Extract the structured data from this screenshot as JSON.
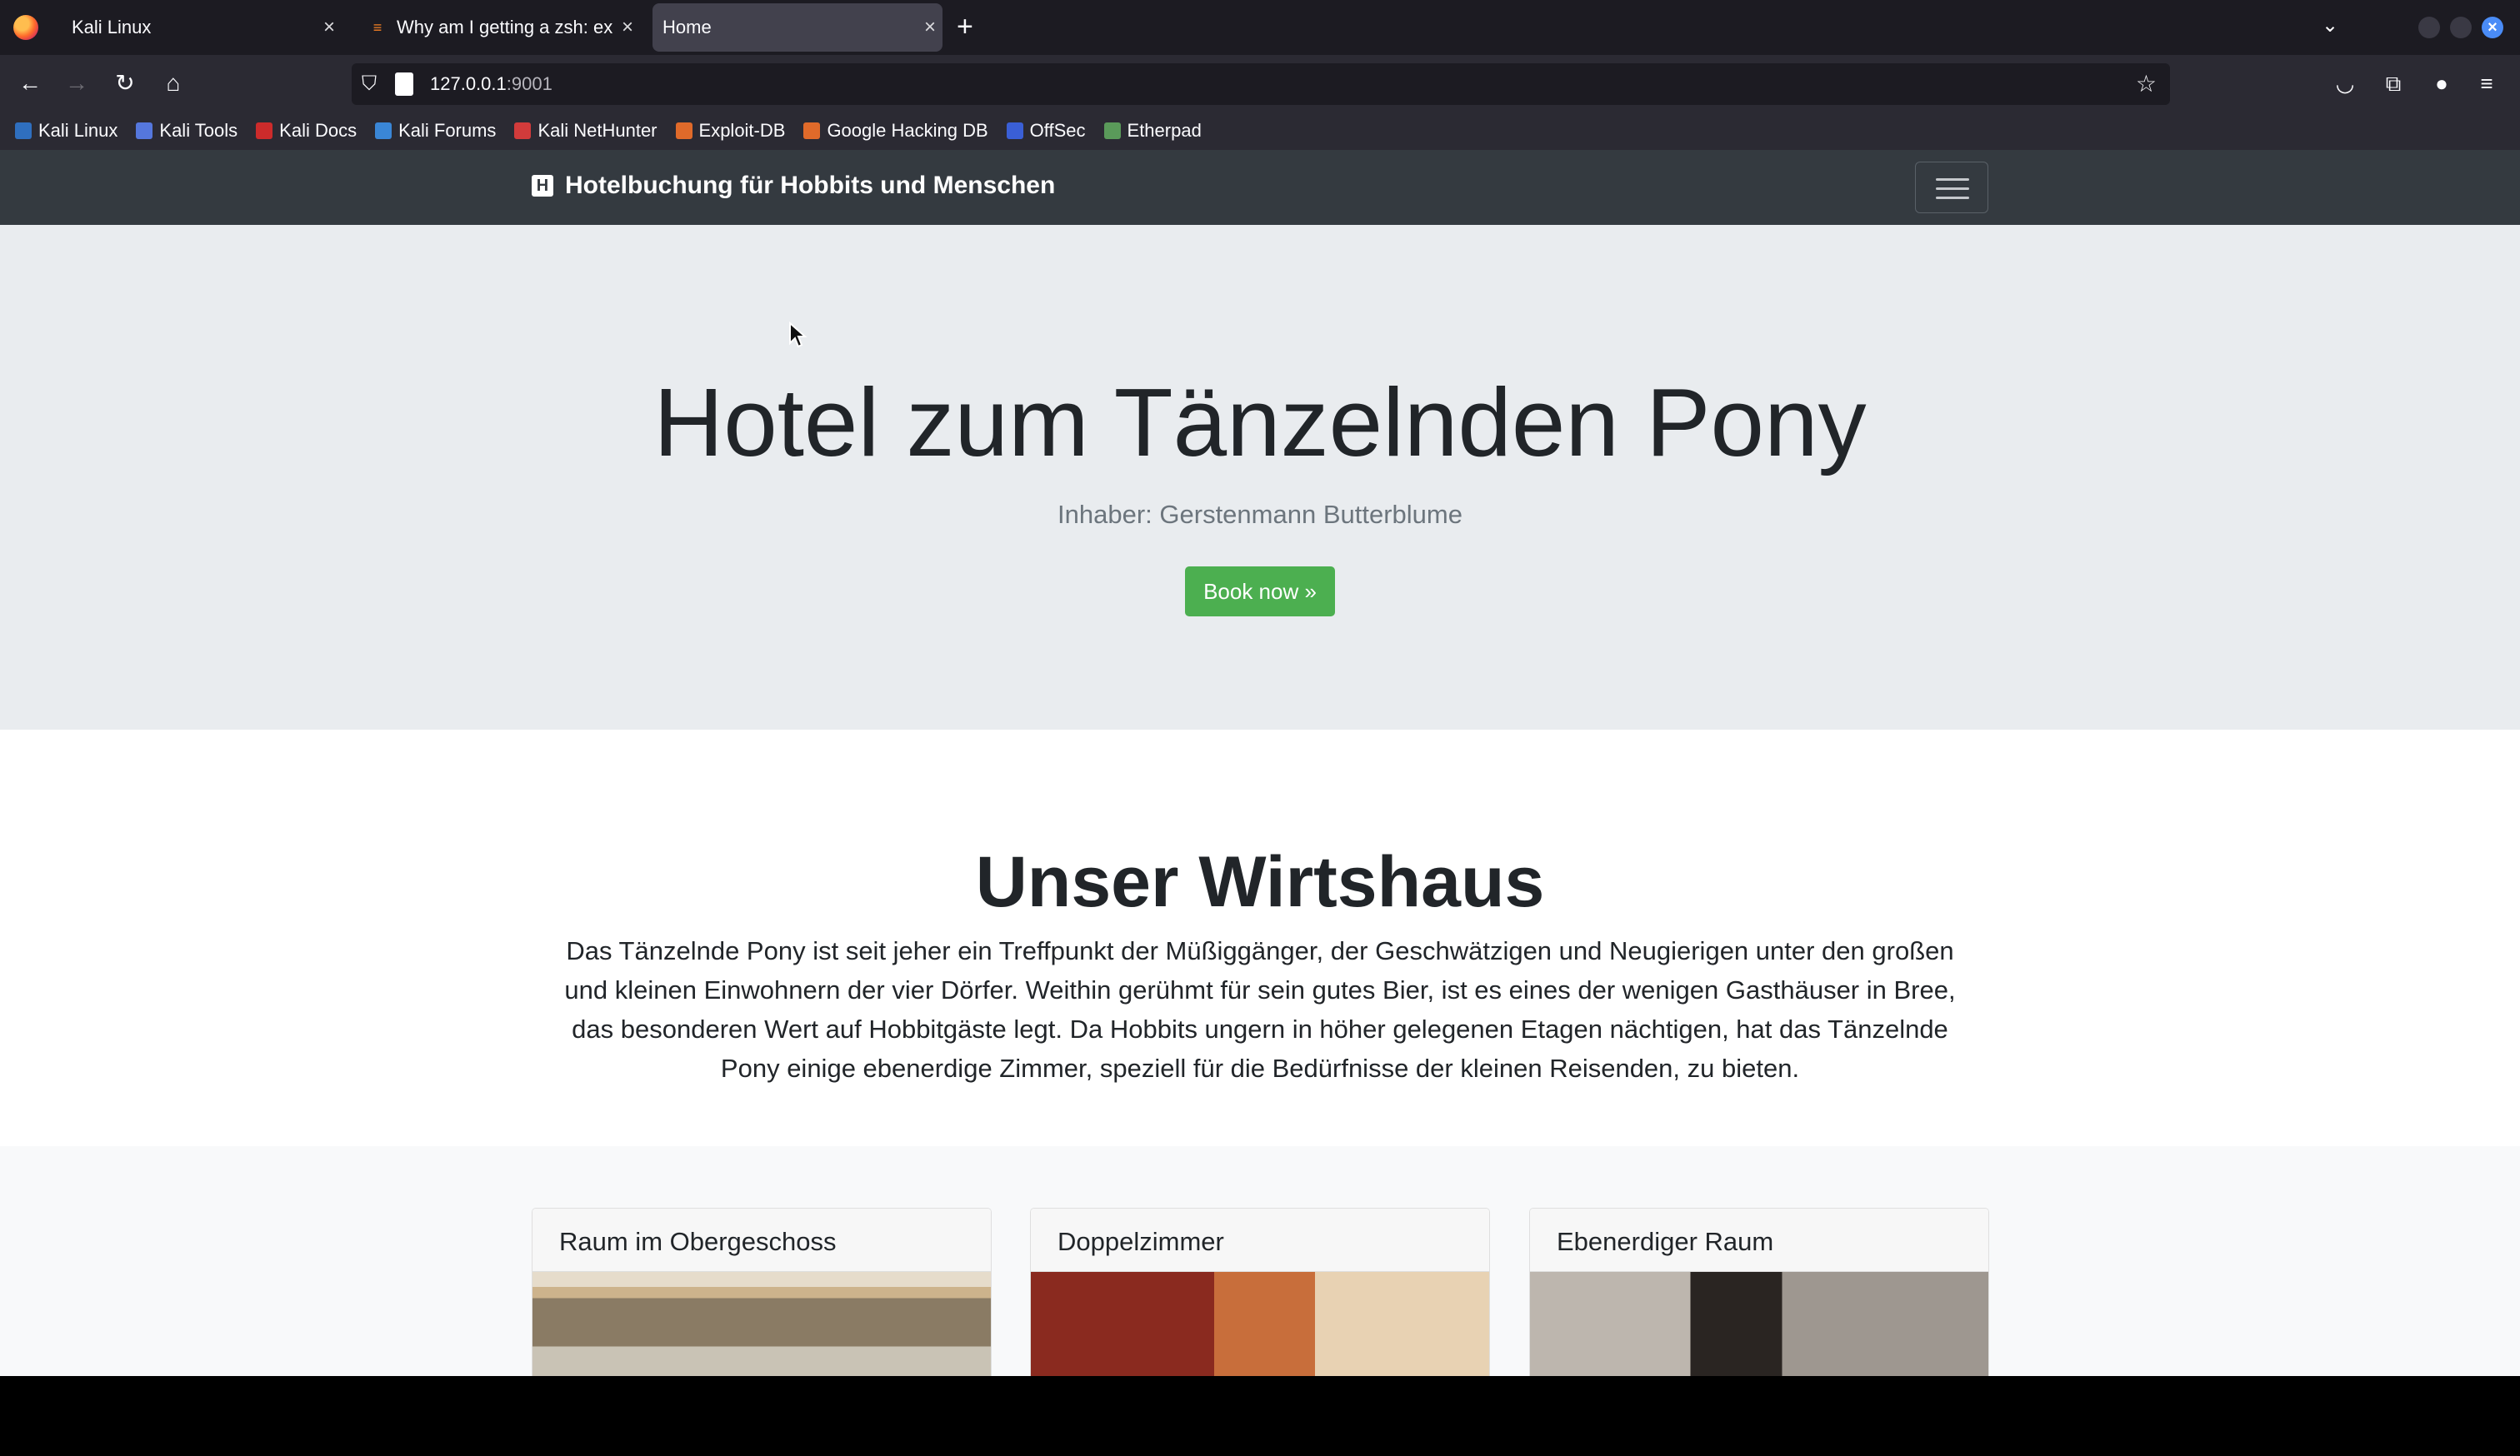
{
  "browser": {
    "tabs": [
      {
        "title": "Kali Linux",
        "active": false
      },
      {
        "title": "Why am I getting a zsh: ex",
        "active": false
      },
      {
        "title": "Home",
        "active": true
      }
    ],
    "url_host": "127.0.0.1",
    "url_port": ":9001",
    "bookmarks": [
      {
        "label": "Kali Linux",
        "color": "#2f6fbf"
      },
      {
        "label": "Kali Tools",
        "color": "#5577dd"
      },
      {
        "label": "Kali Docs",
        "color": "#cc2b2b"
      },
      {
        "label": "Kali Forums",
        "color": "#3a86d6"
      },
      {
        "label": "Kali NetHunter",
        "color": "#d23b3b"
      },
      {
        "label": "Exploit-DB",
        "color": "#e06a2a"
      },
      {
        "label": "Google Hacking DB",
        "color": "#e06a2a"
      },
      {
        "label": "OffSec",
        "color": "#3a5fd6"
      },
      {
        "label": "Etherpad",
        "color": "#5a9a5a"
      }
    ]
  },
  "site": {
    "brand_icon": "H",
    "brand": "Hotelbuchung für Hobbits und Menschen",
    "hero_title": "Hotel zum Tänzelnden Pony",
    "hero_subtitle": "Inhaber: Gerstenmann Butterblume",
    "book_button": "Book now »",
    "about_title": "Unser Wirtshaus",
    "about_text": "Das Tänzelnde Pony ist seit jeher ein Treffpunkt der Müßiggänger, der Geschwätzigen und Neugierigen unter den großen und kleinen Einwohnern der vier Dörfer. Weithin gerühmt für sein gutes Bier, ist es eines der wenigen Gasthäuser in Bree, das besonderen Wert auf Hobbitgäste legt. Da Hobbits ungern in höher gelegenen Etagen nächtigen, hat das Tänzelnde Pony einige ebenerdige Zimmer, speziell für die Bedürfnisse der kleinen Reisenden, zu bieten.",
    "rooms": [
      {
        "title": "Raum im Obergeschoss"
      },
      {
        "title": "Doppelzimmer"
      },
      {
        "title": "Ebenerdiger Raum"
      }
    ]
  }
}
